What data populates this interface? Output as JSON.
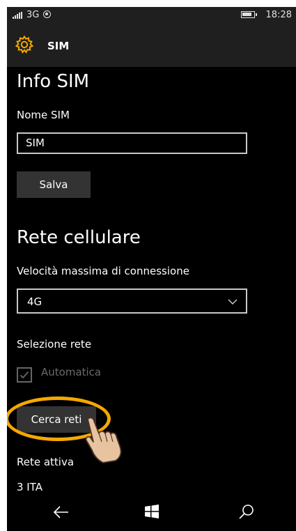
{
  "status_bar": {
    "network": "3G",
    "time": "18:28"
  },
  "header": {
    "icon": "gear-icon",
    "title": "SIM"
  },
  "info_sim": {
    "title": "Info SIM",
    "name_label": "Nome SIM",
    "name_value": "SIM",
    "save_label": "Salva"
  },
  "cellular": {
    "title": "Rete cellulare",
    "max_speed_label": "Velocità massima di connessione",
    "max_speed_value": "4G",
    "network_selection_label": "Selezione rete",
    "automatic_label": "Automatica",
    "automatic_checked": true,
    "search_networks_label": "Cerca reti",
    "active_network_label": "Rete attiva",
    "active_network_value": "3 ITA"
  },
  "annotation": {
    "highlight_color": "#f5a800",
    "pointer_icon": "hand-pointer-icon"
  },
  "bottom_nav": {
    "back_icon": "back-arrow-icon",
    "start_icon": "windows-start-icon",
    "search_icon": "search-icon"
  },
  "colors": {
    "background": "#000000",
    "bar_background": "#1f1f1f",
    "accent": "#f5a800",
    "button_background": "#333333",
    "disabled_text": "#6a6a6a"
  }
}
